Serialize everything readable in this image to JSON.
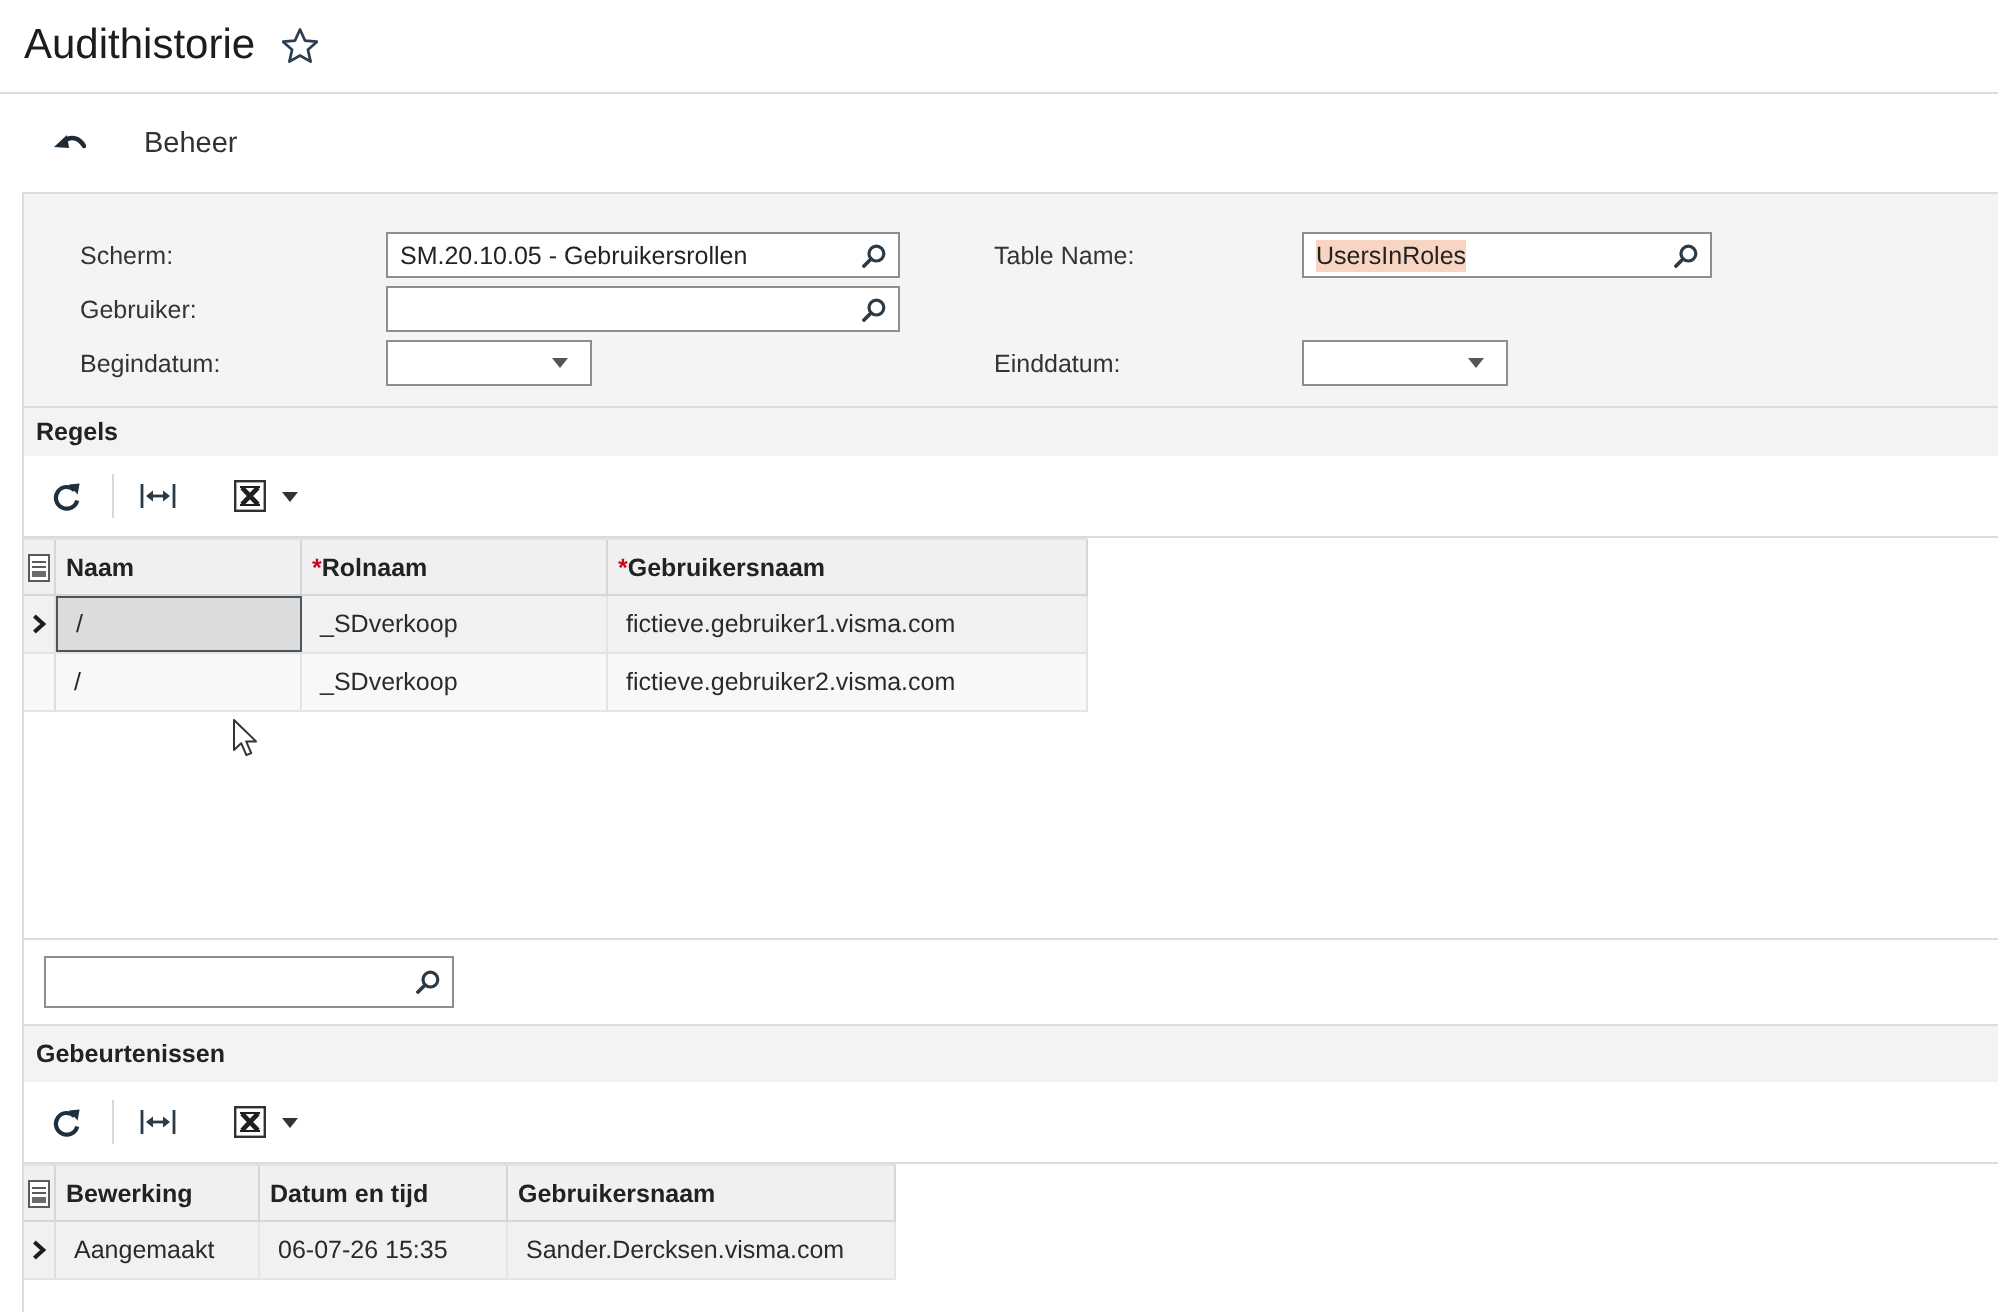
{
  "page": {
    "title": "Audithistorie",
    "favorite": false
  },
  "command_bar": {
    "menu": [
      "Beheer"
    ]
  },
  "filter_rows": [
    {
      "left": {
        "label": "Scherm:",
        "kind": "lookup",
        "value": "SM.20.10.05 - Gebruikersrollen",
        "highlighted": false
      },
      "right": {
        "label": "Table Name:",
        "kind": "lookup",
        "value": "UsersInRoles",
        "highlighted": true
      }
    },
    {
      "left": {
        "label": "Gebruiker:",
        "kind": "lookup"
      }
    },
    {
      "left": {
        "label": "Begindatum:",
        "kind": "date"
      },
      "right": {
        "label": "Einddatum:",
        "kind": "date"
      }
    }
  ],
  "sections": [
    {
      "title": "Regels",
      "columns": [
        {
          "label": "Naam"
        },
        {
          "label": "Rolnaam",
          "required_mark": "*"
        },
        {
          "label": "Gebruikersnaam",
          "required_mark": "*"
        }
      ],
      "rows": [
        {
          "selected": true,
          "cells": [
            {
              "text": "/",
              "focused": true
            },
            {
              "text": "_SDverkoop",
              "focused": false
            },
            {
              "text": "fictieve.gebruiker1.visma.com",
              "focused": false
            }
          ]
        },
        {
          "selected": false,
          "cells": [
            {
              "text": "/",
              "focused": false
            },
            {
              "text": "_SDverkoop",
              "focused": false
            },
            {
              "text": "fictieve.gebruiker2.visma.com",
              "focused": false
            }
          ]
        }
      ],
      "search_below": true
    },
    {
      "title": "Gebeurtenissen",
      "columns": [
        {
          "label": "Bewerking"
        },
        {
          "label": "Datum en tijd"
        },
        {
          "label": "Gebruikersnaam"
        }
      ],
      "rows": [
        {
          "selected": true,
          "cells": [
            {
              "text": "Aangemaakt",
              "focused": false
            },
            {
              "text": "06-07-26 15:35",
              "focused": false
            },
            {
              "text": "Sander.Dercksen.visma.com",
              "focused": false
            }
          ]
        }
      ],
      "search_below": false
    }
  ]
}
